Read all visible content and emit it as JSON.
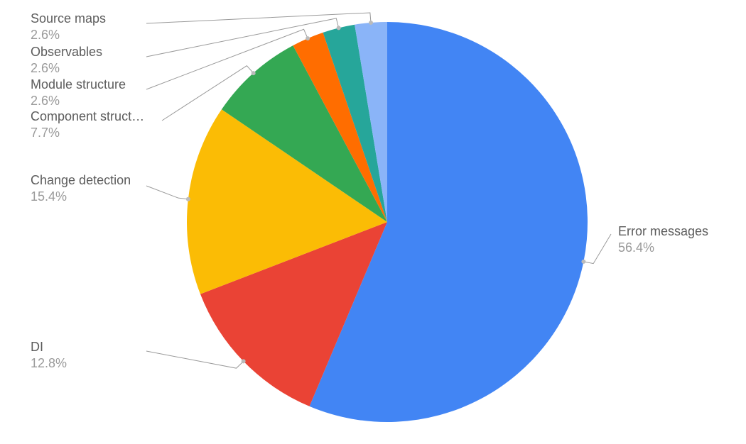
{
  "chart_data": {
    "type": "pie",
    "series": [
      {
        "name": "Error messages",
        "value": 56.4,
        "color": "#4285f4"
      },
      {
        "name": "DI",
        "value": 12.8,
        "color": "#ea4335"
      },
      {
        "name": "Change detection",
        "value": 15.4,
        "color": "#fbbc05"
      },
      {
        "name": "Component struct…",
        "value": 7.7,
        "color": "#34a853"
      },
      {
        "name": "Module structure",
        "value": 2.6,
        "color": "#ff6d00"
      },
      {
        "name": "Observables",
        "value": 2.6,
        "color": "#26a69a"
      },
      {
        "name": "Source maps",
        "value": 2.6,
        "color": "#8ab4f8"
      }
    ]
  },
  "labels": {
    "error_messages": {
      "name": "Error messages",
      "pct": "56.4%"
    },
    "di": {
      "name": "DI",
      "pct": "12.8%"
    },
    "change_detection": {
      "name": "Change detection",
      "pct": "15.4%"
    },
    "component_struct": {
      "name": "Component struct…",
      "pct": "7.7%"
    },
    "module_structure": {
      "name": "Module structure",
      "pct": "2.6%"
    },
    "observables": {
      "name": "Observables",
      "pct": "2.6%"
    },
    "source_maps": {
      "name": "Source maps",
      "pct": "2.6%"
    }
  }
}
